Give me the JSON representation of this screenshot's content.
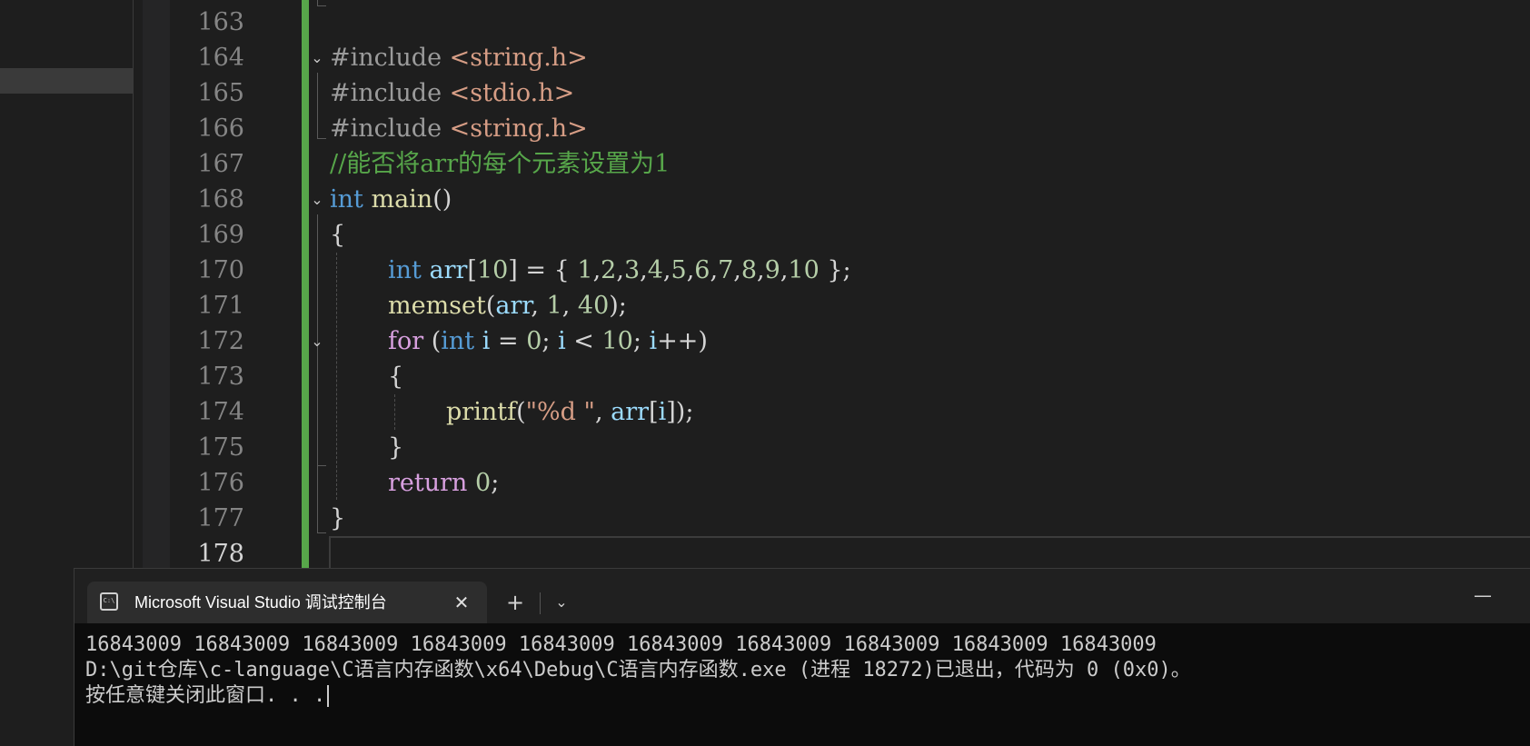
{
  "editor": {
    "lines": [
      {
        "number": "163"
      },
      {
        "number": "164",
        "parts": [
          "#include",
          " ",
          "<string.h>"
        ]
      },
      {
        "number": "165",
        "parts": [
          "#include",
          " ",
          "<stdio.h>"
        ]
      },
      {
        "number": "166",
        "parts": [
          "#include",
          " ",
          "<string.h>"
        ]
      },
      {
        "number": "167",
        "parts": [
          "//能否将arr的每个元素设置为1"
        ]
      },
      {
        "number": "168",
        "parts": [
          "int",
          " ",
          "main",
          "()"
        ]
      },
      {
        "number": "169",
        "parts": [
          "{"
        ]
      },
      {
        "number": "170",
        "parts": [
          "int",
          " ",
          "arr",
          "[",
          "10",
          "] = { ",
          "1",
          ",",
          "2",
          ",",
          "3",
          ",",
          "4",
          ",",
          "5",
          ",",
          "6",
          ",",
          "7",
          ",",
          "8",
          ",",
          "9",
          ",",
          "10",
          " };"
        ]
      },
      {
        "number": "171",
        "parts": [
          "memset",
          "(",
          "arr",
          ", ",
          "1",
          ", ",
          "40",
          ");"
        ]
      },
      {
        "number": "172",
        "parts": [
          "for",
          " (",
          "int",
          " ",
          "i",
          " = ",
          "0",
          "; ",
          "i",
          " < ",
          "10",
          "; ",
          "i",
          "++)"
        ]
      },
      {
        "number": "173",
        "parts": [
          "{"
        ]
      },
      {
        "number": "174",
        "parts": [
          "printf",
          "(",
          "\"%d \"",
          ", ",
          "arr",
          "[",
          "i",
          "]);"
        ]
      },
      {
        "number": "175",
        "parts": [
          "}"
        ]
      },
      {
        "number": "176",
        "parts": [
          "return",
          " ",
          "0",
          ";"
        ]
      },
      {
        "number": "177",
        "parts": [
          "}"
        ]
      },
      {
        "number": "178"
      }
    ]
  },
  "console": {
    "tab_title": "Microsoft Visual Studio 调试控制台",
    "tab_icon": "terminal-icon",
    "close_symbol": "✕",
    "new_tab_symbol": "+",
    "dropdown_symbol": "⌄",
    "minimize_symbol": "—",
    "output": [
      "16843009 16843009 16843009 16843009 16843009 16843009 16843009 16843009 16843009 16843009",
      "D:\\git仓库\\c-language\\C语言内存函数\\x64\\Debug\\C语言内存函数.exe (进程 18272)已退出，代码为 0 (0x0)。",
      "按任意键关闭此窗口. . ."
    ]
  },
  "colors": {
    "editor_bg": "#1e1e1e",
    "change_bar": "#57a64a",
    "comment": "#57a64a",
    "keyword": "#569cd6",
    "function": "#dcdcaa",
    "variable": "#9cdcfe",
    "number": "#b5cea8",
    "control": "#d8a0df",
    "string": "#d69d85",
    "console_bg": "#0c0c0c"
  }
}
